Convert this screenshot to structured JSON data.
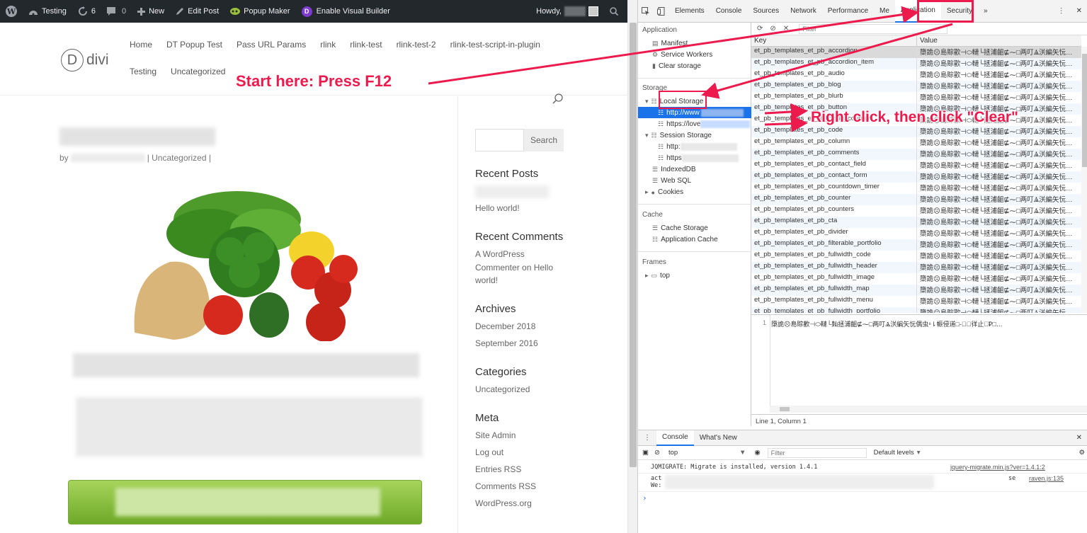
{
  "admin_bar": {
    "site_name": "Testing",
    "updates_count": "6",
    "comments_count": "0",
    "new_label": "New",
    "edit_post_label": "Edit Post",
    "popup_maker_label": "Popup Maker",
    "visual_builder_label": "Enable Visual Builder",
    "howdy_label": "Howdy,"
  },
  "site": {
    "logo_letter": "D",
    "logo_text": "divi",
    "nav_row1": [
      "Home",
      "DT Popup Test",
      "Pass URL Params",
      "rlink",
      "rlink-test",
      "rlink-test-2",
      "rlink-test-script-in-plugin"
    ],
    "nav_row2": [
      "Testing",
      "Uncategorized"
    ]
  },
  "post": {
    "meta_by": "by",
    "meta_category": "| Uncategorized |"
  },
  "sidebar": {
    "search_button": "Search",
    "recent_posts_title": "Recent Posts",
    "recent_posts": [
      "Hello world!"
    ],
    "recent_comments_title": "Recent Comments",
    "recent_comment_lines": [
      "A WordPress",
      "Commenter on Hello",
      "world!"
    ],
    "archives_title": "Archives",
    "archives": [
      "December 2018",
      "September 2016"
    ],
    "categories_title": "Categories",
    "categories": [
      "Uncategorized"
    ],
    "meta_title": "Meta",
    "meta_links": [
      "Site Admin",
      "Log out",
      "Entries RSS",
      "Comments RSS",
      "WordPress.org"
    ]
  },
  "devtools": {
    "tabs": [
      "Elements",
      "Console",
      "Sources",
      "Network",
      "Performance",
      "Me",
      "Application",
      "Security"
    ],
    "active_tab": "Application",
    "filter_placeholder": "Filter",
    "nav": {
      "application_header": "Application",
      "manifest": "Manifest",
      "service_workers": "Service Workers",
      "clear_storage": "Clear storage",
      "storage_header": "Storage",
      "local_storage": "Local Storage",
      "local_storage_item1": "http://www",
      "local_storage_item2": "https://love",
      "session_storage": "Session Storage",
      "session_storage_item1": "http:",
      "session_storage_item2": "https",
      "indexeddb": "IndexedDB",
      "web_sql": "Web SQL",
      "cookies": "Cookies",
      "cache_header": "Cache",
      "cache_storage": "Cache Storage",
      "application_cache": "Application Cache",
      "frames_header": "Frames",
      "frames_top": "top"
    },
    "table": {
      "key_header": "Key",
      "value_header": "Value",
      "value_text": "㯐詭☹๮島賩歡⊣⬭轋└拯浦齟⋢⁓□两叮Ⱑ浂編⽮忨…",
      "rows": [
        "et_pb_templates_et_pb_accordion",
        "et_pb_templates_et_pb_accordion_item",
        "et_pb_templates_et_pb_audio",
        "et_pb_templates_et_pb_blog",
        "et_pb_templates_et_pb_blurb",
        "et_pb_templates_et_pb_button",
        "et_pb_templates_et_pb_circle_counter",
        "et_pb_templates_et_pb_code",
        "et_pb_templates_et_pb_column",
        "et_pb_templates_et_pb_comments",
        "et_pb_templates_et_pb_contact_field",
        "et_pb_templates_et_pb_contact_form",
        "et_pb_templates_et_pb_countdown_timer",
        "et_pb_templates_et_pb_counter",
        "et_pb_templates_et_pb_counters",
        "et_pb_templates_et_pb_cta",
        "et_pb_templates_et_pb_divider",
        "et_pb_templates_et_pb_filterable_portfolio",
        "et_pb_templates_et_pb_fullwidth_code",
        "et_pb_templates_et_pb_fullwidth_header",
        "et_pb_templates_et_pb_fullwidth_image",
        "et_pb_templates_et_pb_fullwidth_map",
        "et_pb_templates_et_pb_fullwidth_menu",
        "et_pb_templates_et_pb_fullwidth_portfolio"
      ]
    },
    "preview_line_number": "1",
    "preview_text": "㯐詭☹๮島賩歡⊣⬭轋└䴮拯浦齟⋢⁓□两叮Ⱑ浂編⽮忨偶⾍⁶⇂帪侵道□-傈⃐徉止注̃⃎□…",
    "status_line": "Line 1, Column 1",
    "drawer_tabs": [
      "Console",
      "What's New"
    ],
    "console_context": "top",
    "console_filter_placeholder": "Filter",
    "console_levels": "Default levels",
    "console_msg1": "JQMIGRATE: Migrate is installed, version 1.4.1",
    "console_link1": "jquery-migrate.min.js?ver=1.4.1:2",
    "console_msg2a": "act",
    "console_msg2b": "We:",
    "console_msg2c": "se",
    "console_link2": "raven.js:135",
    "console_prompt": "›"
  },
  "annotations": {
    "start_here": "Start here: Press F12",
    "right_click": "Right click, then click \"Clear\""
  },
  "colors": {
    "annotation": "#ed1b4d",
    "devtools_accent": "#1a73e8",
    "admin_bar_bg": "#23282d",
    "button_green": "#82b93c"
  }
}
